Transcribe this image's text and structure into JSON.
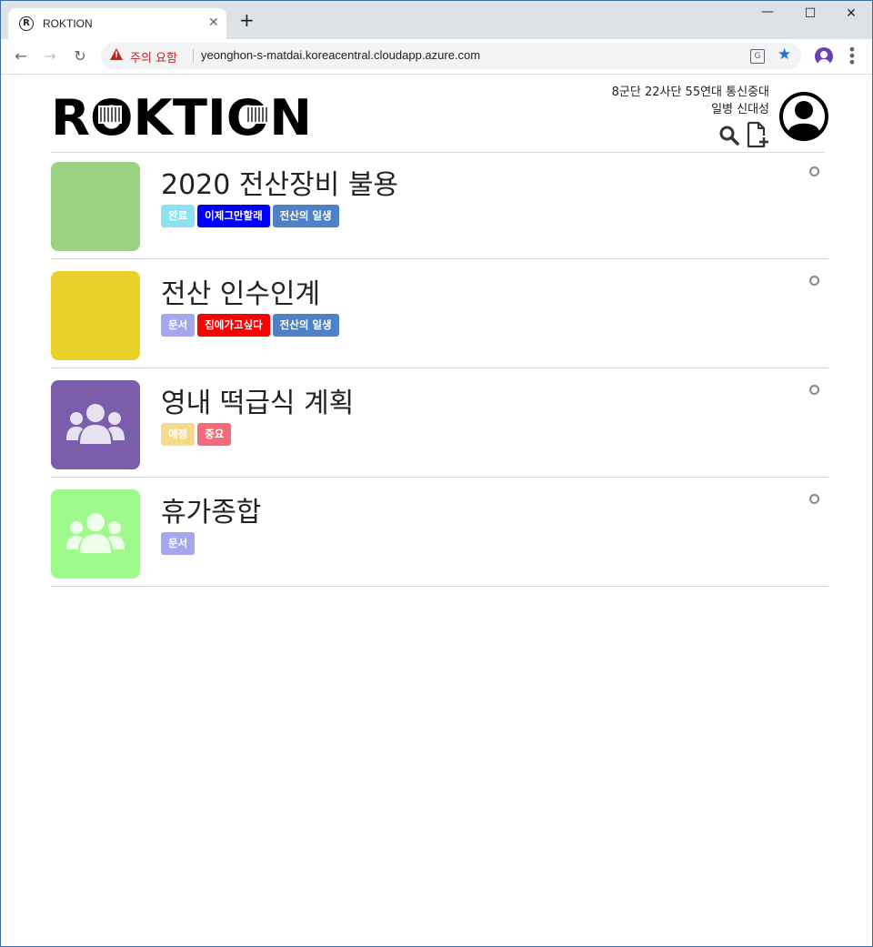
{
  "browser": {
    "tab_title": "ROKTION",
    "tab_favicon_char": "R",
    "new_tab": "+",
    "close_char": "✕",
    "security_warning": "주의 요함",
    "url": "yeonghon-s-matdai.koreacentral.cloudapp.azure.com"
  },
  "header": {
    "logo_text": "ROKTION",
    "unit": "8군단 22사단 55연대 통신중대",
    "rank_name": "일병 신대성"
  },
  "items": [
    {
      "title": "2020 전산장비 불용",
      "thumb_color": "#9ad282",
      "thumb_icon": "",
      "tags": [
        {
          "label": "완료",
          "color": "#8be3f2"
        },
        {
          "label": "이제그만할래",
          "color": "#0000ff"
        },
        {
          "label": "전산의 일생",
          "color": "#4f81c6"
        }
      ]
    },
    {
      "title": "전산 인수인계",
      "thumb_color": "#e9d12b",
      "thumb_icon": "",
      "tags": [
        {
          "label": "문서",
          "color": "#a4a7f0"
        },
        {
          "label": "집에가고싶다",
          "color": "#ff0000"
        },
        {
          "label": "전산의 일생",
          "color": "#4f81c6"
        }
      ]
    },
    {
      "title": "영내 떡급식 계획",
      "thumb_color": "#7c5dac",
      "thumb_icon": "group-icon",
      "tags": [
        {
          "label": "예정",
          "color": "#f7d98a"
        },
        {
          "label": "중요",
          "color": "#f56a7a"
        }
      ]
    },
    {
      "title": "휴가종합",
      "thumb_color": "#9efa8a",
      "thumb_icon": "group-icon",
      "tags": [
        {
          "label": "문서",
          "color": "#a4a7f0"
        }
      ]
    }
  ]
}
